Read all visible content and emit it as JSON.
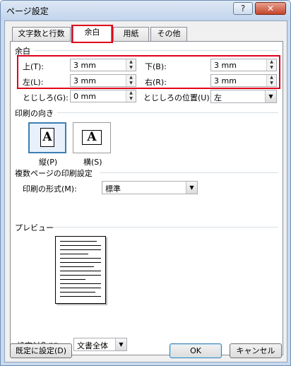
{
  "window": {
    "title": "ページ設定",
    "help_label": "?",
    "close_label": "✕"
  },
  "tabs": [
    {
      "label": "文字数と行数"
    },
    {
      "label": "余白"
    },
    {
      "label": "用紙"
    },
    {
      "label": "その他"
    }
  ],
  "margins": {
    "section_label": "余白",
    "top": {
      "label": "上(T):",
      "value": "3 mm"
    },
    "bottom": {
      "label": "下(B):",
      "value": "3 mm"
    },
    "left": {
      "label": "左(L):",
      "value": "3 mm"
    },
    "right": {
      "label": "右(R):",
      "value": "3 mm"
    },
    "gutter": {
      "label": "とじしろ(G):",
      "value": "0 mm"
    },
    "gutter_position": {
      "label": "とじしろの位置(U):",
      "value": "左"
    }
  },
  "orientation": {
    "section_label": "印刷の向き",
    "portrait": {
      "label": "縦(P)",
      "glyph": "A"
    },
    "landscape": {
      "label": "横(S)",
      "glyph": "A"
    }
  },
  "multiple_pages": {
    "section_label": "複数ページの印刷設定",
    "format_label": "印刷の形式(M):",
    "format_value": "標準"
  },
  "preview": {
    "section_label": "プレビュー"
  },
  "apply_to": {
    "label": "設定対象(Y):",
    "value": "文書全体"
  },
  "buttons": {
    "default_label": "既定に設定(D)",
    "ok_label": "OK",
    "cancel_label": "キャンセル"
  },
  "icons": {
    "spin": "spin-arrows-icon",
    "dropdown": "chevron-down-icon"
  },
  "colors": {
    "highlight": "#e0001a",
    "selected_border": "#3c7fb1"
  }
}
